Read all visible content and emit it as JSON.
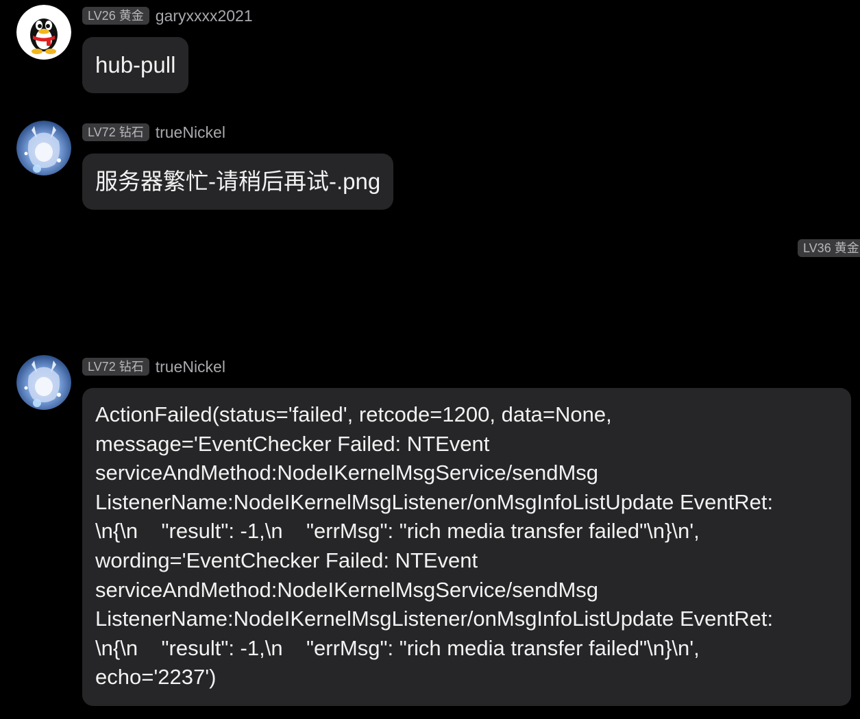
{
  "messages": [
    {
      "level_badge": "LV26 黄金",
      "username": "garyxxxx2021",
      "avatar": "qq-penguin-avatar",
      "text": "hub-pull"
    },
    {
      "level_badge": "LV72 钻石",
      "username": "trueNickel",
      "avatar": "anime-character-avatar",
      "text": "服务器繁忙-请稍后再试-.png"
    },
    {
      "level_badge": "LV36 黄金"
    },
    {
      "level_badge": "LV72 钻石",
      "username": "trueNickel",
      "avatar": "anime-character-avatar",
      "text": "ActionFailed(status='failed', retcode=1200, data=None,\nmessage='EventChecker Failed: NTEvent\nserviceAndMethod:NodeIKernelMsgService/sendMsg\nListenerName:NodeIKernelMsgListener/onMsgInfoListUpdate EventRet:\n\\n{\\n    \"result\": -1,\\n    \"errMsg\": \"rich media transfer failed\"\\n}\\n',\nwording='EventChecker Failed: NTEvent\nserviceAndMethod:NodeIKernelMsgService/sendMsg\nListenerName:NodeIKernelMsgListener/onMsgInfoListUpdate EventRet:\n\\n{\\n    \"result\": -1,\\n    \"errMsg\": \"rich media transfer failed\"\\n}\\n',\necho='2237')"
    }
  ],
  "colors": {
    "background": "#000000",
    "bubble": "#262628",
    "badge_bg": "#3a3a3c",
    "badge_text": "#b8b8bc",
    "username_text": "#a8a8ad",
    "message_text": "#f2f2f2"
  }
}
